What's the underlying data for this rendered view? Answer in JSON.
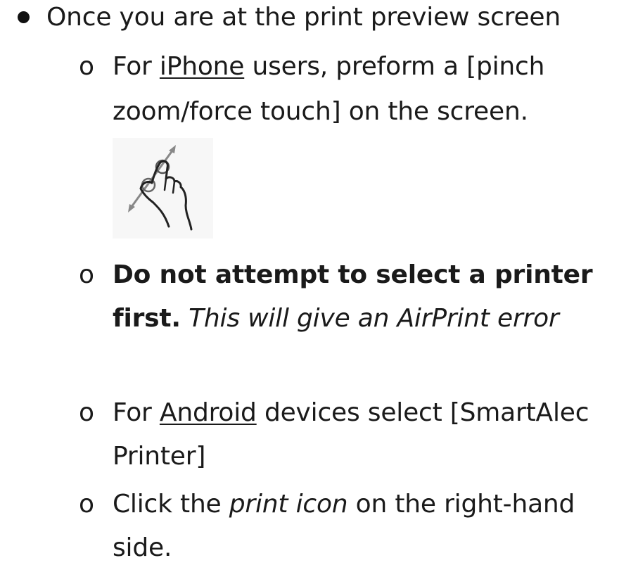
{
  "list": {
    "level1": {
      "bullet": "•",
      "text": "Once you are at the print preview screen"
    },
    "iphone": {
      "marker": "o",
      "prefix": "For ",
      "device": "iPhone",
      "middle": " users, preform a [pinch",
      "line2": "zoom/force touch] on the screen."
    },
    "gesture": {
      "icon": "pinch-zoom-gesture-icon"
    },
    "warning": {
      "marker": "o",
      "bold_text": "Do not attempt to select a printer",
      "bold_text2": "first.",
      "italic_text": " This will give an AirPrint error"
    },
    "android": {
      "marker": "o",
      "prefix": "For ",
      "device": "Android",
      "middle": " devices select [SmartAlec",
      "line2": "Printer]"
    },
    "print": {
      "marker": "o",
      "prefix": "Click the ",
      "italic": "print icon",
      "suffix": " on the right-hand",
      "line2": "side."
    }
  }
}
